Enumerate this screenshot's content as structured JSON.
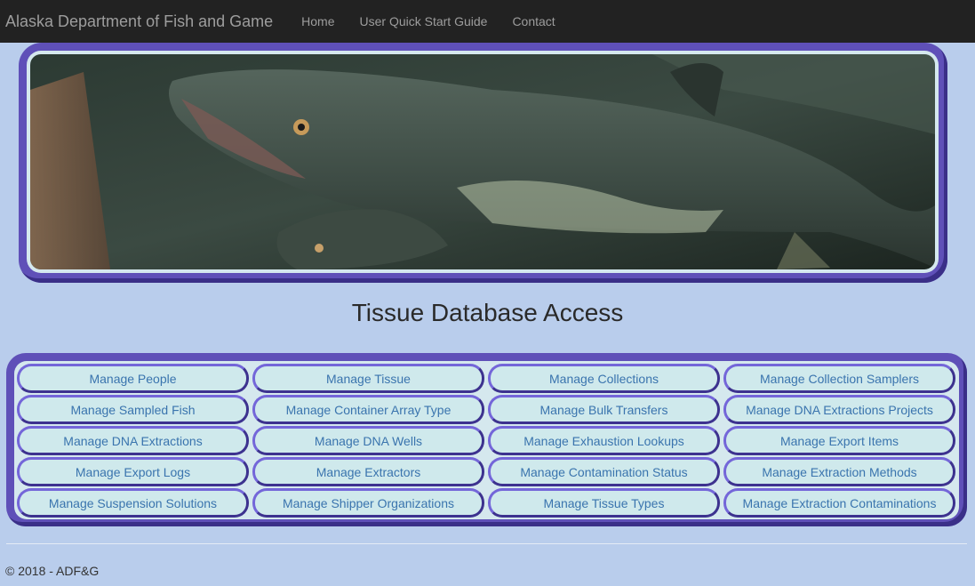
{
  "navbar": {
    "brand": "Alaska Department of Fish and Game",
    "links": [
      "Home",
      "User Quick Start Guide",
      "Contact"
    ]
  },
  "hero": {
    "image": "salmon-underwater-photo"
  },
  "page": {
    "title": "Tissue Database Access"
  },
  "buttons": [
    "Manage People",
    "Manage Tissue",
    "Manage Collections",
    "Manage Collection Samplers",
    "Manage Sampled Fish",
    "Manage Container Array Type",
    "Manage Bulk Transfers",
    "Manage DNA Extractions Projects",
    "Manage DNA Extractions",
    "Manage DNA Wells",
    "Manage Exhaustion Lookups",
    "Manage Export Items",
    "Manage Export Logs",
    "Manage Extractors",
    "Manage Contamination Status",
    "Manage Extraction Methods",
    "Manage Suspension Solutions",
    "Manage Shipper Organizations",
    "Manage Tissue Types",
    "Manage Extraction Contaminations"
  ],
  "footer": {
    "text": "© 2018 - ADF&G"
  },
  "colors": {
    "background": "#b9cdec",
    "frame": "#5f50b8",
    "button_fill": "#cfe9ec",
    "button_text": "#3a74ae"
  }
}
